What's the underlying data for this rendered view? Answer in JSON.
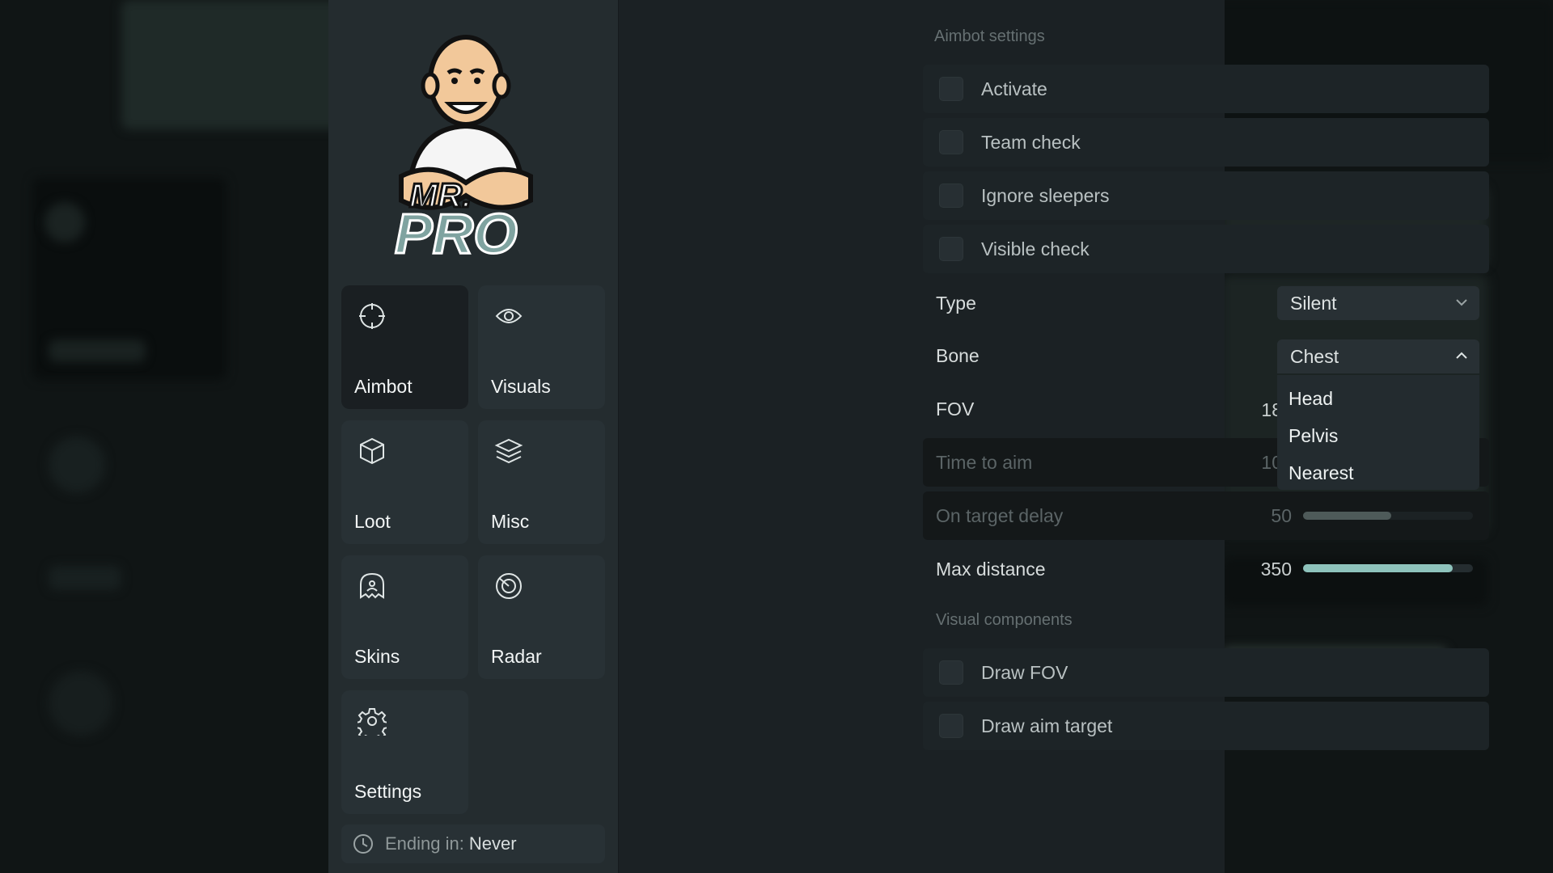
{
  "colors": {
    "accent": "#8ec3bc",
    "sidebar_bg": "#242c2f",
    "content_bg": "#1b2124",
    "tile_bg": "#283135",
    "active_tile_bg": "#1a1f22"
  },
  "sidebar": {
    "logo_text_line1": "MR.",
    "logo_text_line2": "PRO",
    "items": [
      {
        "label": "Aimbot",
        "icon": "crosshair-icon",
        "active": true
      },
      {
        "label": "Visuals",
        "icon": "eye-icon",
        "active": false
      },
      {
        "label": "Loot",
        "icon": "cube-icon",
        "active": false
      },
      {
        "label": "Misc",
        "icon": "layers-icon",
        "active": false
      },
      {
        "label": "Skins",
        "icon": "ghost-icon",
        "active": false
      },
      {
        "label": "Radar",
        "icon": "radar-icon",
        "active": false
      },
      {
        "label": "Settings",
        "icon": "gear-icon",
        "active": false
      }
    ],
    "footer": {
      "prefix": "Ending in:",
      "value": "Never",
      "icon": "clock-icon"
    }
  },
  "aimbot": {
    "section_title": "Aimbot settings",
    "checks": [
      {
        "label": "Activate",
        "checked": false
      },
      {
        "label": "Team check",
        "checked": false
      },
      {
        "label": "Ignore sleepers",
        "checked": false
      },
      {
        "label": "Visible check",
        "checked": false
      }
    ],
    "type": {
      "label": "Type",
      "value": "Silent"
    },
    "bone": {
      "label": "Bone",
      "value": "Chest",
      "open": true,
      "options": [
        "Head",
        "Pelvis",
        "Nearest"
      ]
    },
    "fov": {
      "label": "FOV",
      "value": "18"
    },
    "time_to_aim": {
      "label": "Time to aim",
      "value": "10"
    },
    "on_target_delay": {
      "label": "On target delay",
      "value": "50",
      "fraction": 0.52
    },
    "max_distance": {
      "label": "Max distance",
      "value": "350",
      "fraction": 0.88
    }
  },
  "visual_components": {
    "section_title": "Visual components",
    "checks": [
      {
        "label": "Draw FOV",
        "checked": false
      },
      {
        "label": "Draw aim target",
        "checked": false
      }
    ]
  }
}
